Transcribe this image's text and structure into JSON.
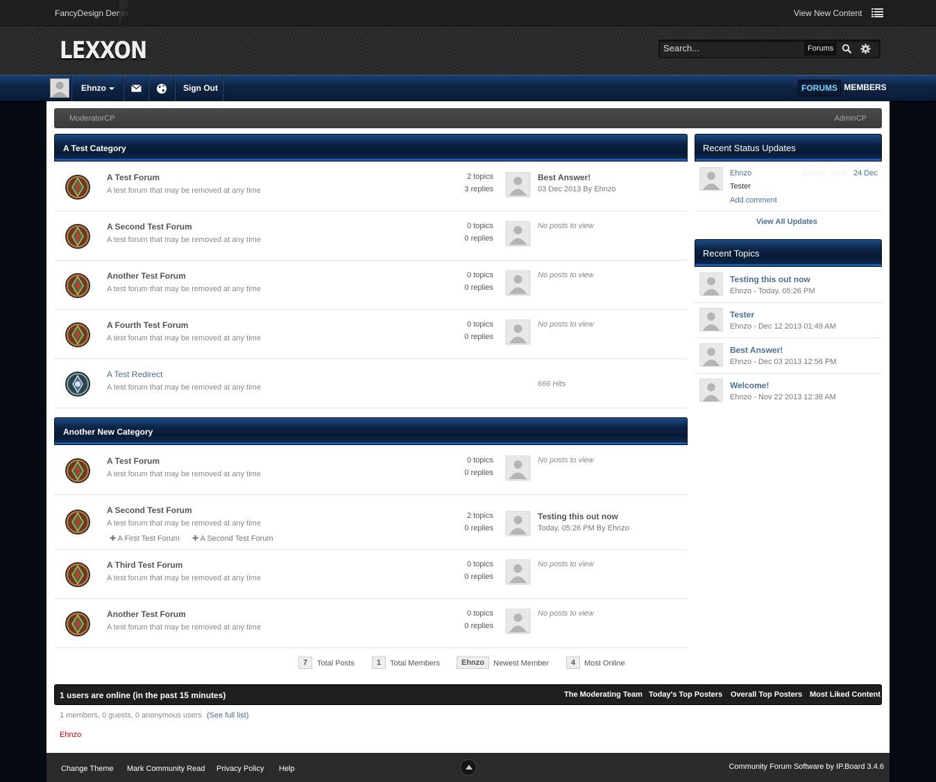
{
  "topbar": {
    "site_name": "FancyDesign Demo",
    "view_new": "View New Content"
  },
  "header": {
    "logo": "LEXXON",
    "search_placeholder": "Search...",
    "search_scope": "Forums"
  },
  "userbar": {
    "username": "Ehnzo",
    "sign_out": "Sign Out",
    "tabs": [
      {
        "label": "FORUMS"
      },
      {
        "label": "MEMBERS"
      }
    ]
  },
  "modbar": {
    "moderatorcp": "ModeratorCP",
    "admincp": "AdminCP"
  },
  "categories": [
    {
      "title": "A Test Category",
      "forums": [
        {
          "name": "A Test Forum",
          "desc": "A test forum that may be removed at any time",
          "topics": "2 topics",
          "replies": "3 replies",
          "last_title": "Best Answer!",
          "last_meta": "03 Dec 2013 By Ehnzo"
        },
        {
          "name": "A Second Test Forum",
          "desc": "A test forum that may be removed at any time",
          "topics": "0 topics",
          "replies": "0 replies",
          "no_posts": "No posts to view"
        },
        {
          "name": "Another Test Forum",
          "desc": "A test forum that may be removed at any time",
          "topics": "0 topics",
          "replies": "0 replies",
          "no_posts": "No posts to view"
        },
        {
          "name": "A Fourth Test Forum",
          "desc": "A test forum that may be removed at any time",
          "topics": "0 topics",
          "replies": "0 replies",
          "no_posts": "No posts to view"
        },
        {
          "name": "A Test Redirect",
          "desc": "A test forum that may be removed at any time",
          "hits": "666 Hits"
        }
      ]
    },
    {
      "title": "Another New Category",
      "forums": [
        {
          "name": "A Test Forum",
          "desc": "A test forum that may be removed at any time",
          "topics": "0 topics",
          "replies": "0 replies",
          "no_posts": "No posts to view"
        },
        {
          "name": "A Second Test Forum",
          "desc": "A test forum that may be removed at any time",
          "topics": "2 topics",
          "replies": "0 replies",
          "last_title": "Testing this out now",
          "last_meta": "Today, 05:26 PM By Ehnzo",
          "subforums": [
            "A First Test Forum",
            "A Second Test Forum"
          ]
        },
        {
          "name": "A Third Test Forum",
          "desc": "A test forum that may be removed at any time",
          "topics": "0 topics",
          "replies": "0 replies",
          "no_posts": "No posts to view"
        },
        {
          "name": "Another Test Forum",
          "desc": "A test forum that may be removed at any time",
          "topics": "0 topics",
          "replies": "0 replies",
          "no_posts": "No posts to view"
        }
      ]
    }
  ],
  "sidebar": {
    "status_title": "Recent Status Updates",
    "status": {
      "user": "Ehnzo",
      "text": "Tester",
      "delete": "Delete",
      "lock": "Lock",
      "date": "24 Dec",
      "add_comment": "Add comment"
    },
    "view_all": "View All Updates",
    "topics_title": "Recent Topics",
    "topics": [
      {
        "title": "Testing this out now",
        "meta": "Ehnzo - Today, 05:26 PM"
      },
      {
        "title": "Tester",
        "meta": "Ehnzo - Dec 12 2013 01:49 AM"
      },
      {
        "title": "Best Answer!",
        "meta": "Ehnzo - Dec 03 2013 12:56 PM"
      },
      {
        "title": "Welcome!",
        "meta": "Ehnzo - Nov 22 2013 12:38 AM"
      }
    ]
  },
  "stats": [
    {
      "value": "7",
      "label": "Total Posts"
    },
    {
      "value": "1",
      "label": "Total Members"
    },
    {
      "value": "Ehnzo",
      "label": "Newest Member"
    },
    {
      "value": "4",
      "label": "Most Online"
    }
  ],
  "online": {
    "title": "1 users are online (in the past 15 minutes)",
    "links": [
      "The Moderating Team",
      "Today's Top Posters",
      "Overall Top Posters",
      "Most Liked Content"
    ],
    "counts": "1 members, 0 guests, 0 anonymous users",
    "full_list": "(See full list)",
    "user": "Ehnzo"
  },
  "footer": {
    "links": [
      "Change Theme",
      "Mark Community Read",
      "Privacy Policy",
      "Help"
    ],
    "powered": "Community Forum Software by IP.Board 3.4.6"
  }
}
